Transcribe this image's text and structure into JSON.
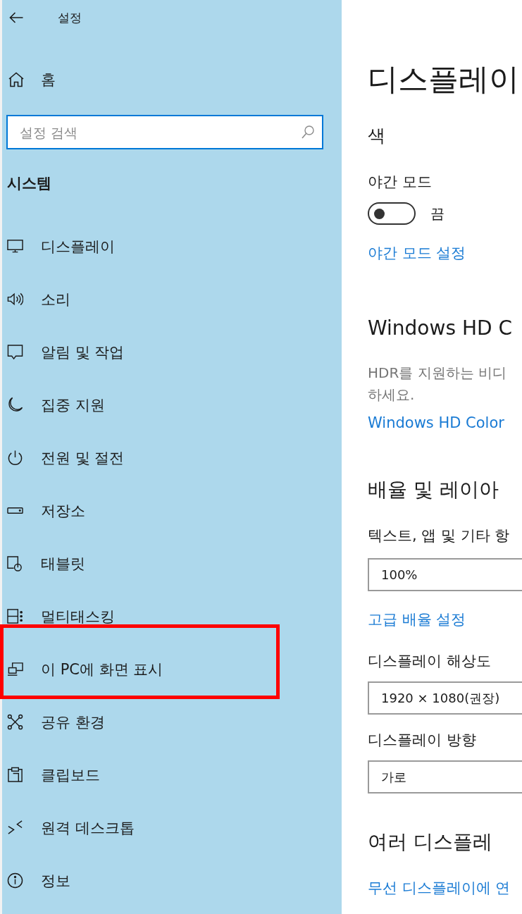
{
  "window": {
    "title": "설정"
  },
  "sidebar": {
    "home": "홈",
    "search": {
      "placeholder": "설정 검색"
    },
    "section_title": "시스템",
    "items": [
      {
        "label": "디스플레이",
        "highlighted": false
      },
      {
        "label": "소리",
        "highlighted": false
      },
      {
        "label": "알림 및 작업",
        "highlighted": false
      },
      {
        "label": "집중 지원",
        "highlighted": false
      },
      {
        "label": "전원 및 절전",
        "highlighted": false
      },
      {
        "label": "저장소",
        "highlighted": false
      },
      {
        "label": "태블릿",
        "highlighted": false
      },
      {
        "label": "멀티태스킹",
        "highlighted": false
      },
      {
        "label": "이 PC에 화면 표시",
        "highlighted": true
      },
      {
        "label": "공유 환경",
        "highlighted": false
      },
      {
        "label": "클립보드",
        "highlighted": false
      },
      {
        "label": "원격 데스크톱",
        "highlighted": false
      },
      {
        "label": "정보",
        "highlighted": false
      }
    ]
  },
  "content": {
    "title": "디스플레이",
    "sections": [
      {
        "heading": "색",
        "items": [
          {
            "kind": "toggle",
            "label": "야간 모드",
            "on": false,
            "state": "끔"
          },
          {
            "kind": "link",
            "text": "야간 모드 설정"
          }
        ]
      },
      {
        "heading": "Windows HD C",
        "items": [
          {
            "kind": "text",
            "lines": [
              "HDR를 지원하는 비디",
              "하세요."
            ]
          },
          {
            "kind": "link",
            "text": "Windows HD Color"
          }
        ]
      },
      {
        "heading": "배율 및 레이아",
        "items": [
          {
            "kind": "dropdown",
            "label": "텍스트, 앱 및 기타 항",
            "value": "100%"
          },
          {
            "kind": "link",
            "text": "고급 배율 설정"
          },
          {
            "kind": "dropdown",
            "label": "디스플레이 해상도",
            "value": "1920 × 1080(권장)"
          },
          {
            "kind": "dropdown",
            "label": "디스플레이 방향",
            "value": "가로"
          }
        ]
      },
      {
        "heading": "여러 디스플레",
        "items": [
          {
            "kind": "link",
            "text": "무선 디스플레이에 연"
          }
        ]
      }
    ]
  }
}
